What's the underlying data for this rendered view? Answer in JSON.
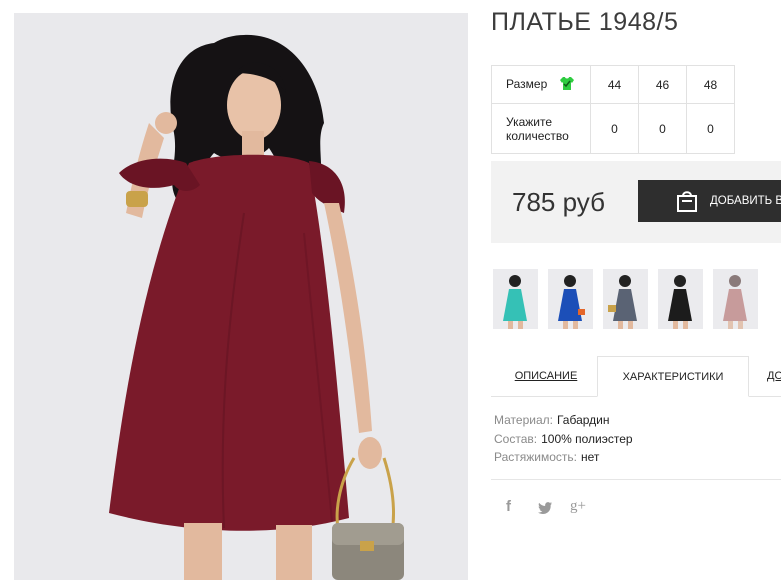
{
  "product": {
    "title": "ПЛАТЬЕ 1948/5",
    "main_image_alt": "Бордовое платье"
  },
  "size_table": {
    "size_label": "Размер",
    "sizes": [
      "44",
      "46",
      "48"
    ],
    "qty_label": "Укажите количество",
    "quantities": [
      "0",
      "0",
      "0"
    ]
  },
  "purchase": {
    "price": "785 руб",
    "add_button": "ДОБАВИТЬ В КОРЗИНУ"
  },
  "thumbnails": [
    {
      "name": "thumb-turquoise",
      "color": "#35c1b6"
    },
    {
      "name": "thumb-blue",
      "color": "#1c4fb8"
    },
    {
      "name": "thumb-gray",
      "color": "#5a6374"
    },
    {
      "name": "thumb-black",
      "color": "#1c1c1c"
    },
    {
      "name": "thumb-pink",
      "color": "#c79b9b"
    }
  ],
  "tabs": {
    "description": "ОПИСАНИЕ",
    "characteristics": "ХАРАКТЕРИСТИКИ",
    "more": "ДО"
  },
  "specs": [
    {
      "key": "Материал:",
      "value": "Габардин"
    },
    {
      "key": "Состав:",
      "value": "100% полиэстер"
    },
    {
      "key": "Растяжимость:",
      "value": "нет"
    }
  ],
  "social": {
    "facebook": "f",
    "twitter": "t",
    "googleplus": "g+"
  },
  "colors": {
    "dress": "#7a1a2a",
    "button": "#2e2e2e",
    "size_icon": "#2ecc40",
    "price_bg": "#f2f2f2"
  }
}
